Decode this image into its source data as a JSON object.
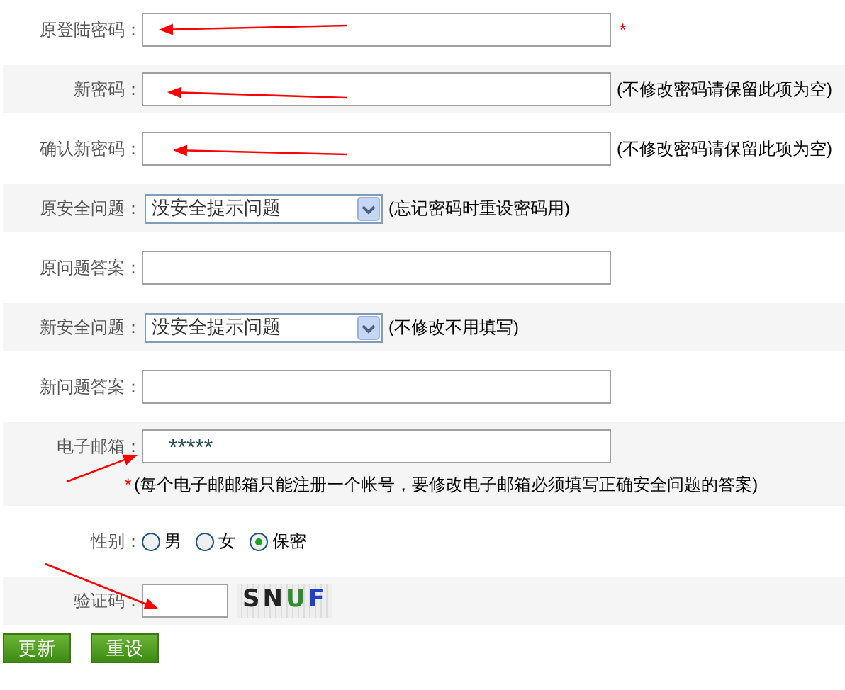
{
  "form": {
    "rows": [
      {
        "kind": "text",
        "label": "原登陆密码：",
        "value": "",
        "mark": "*"
      },
      {
        "kind": "text",
        "label": "新密码：",
        "value": "",
        "note": "(不修改密码请保留此项为空)"
      },
      {
        "kind": "text",
        "label": "确认新密码：",
        "value": "",
        "note": "(不修改密码请保留此项为空)"
      },
      {
        "kind": "select",
        "label": "原安全问题：",
        "value": "没安全提示问题",
        "note": "(忘记密码时重设密码用)"
      },
      {
        "kind": "text",
        "label": "原问题答案：",
        "value": ""
      },
      {
        "kind": "select",
        "label": "新安全问题：",
        "value": "没安全提示问题",
        "note": "(不修改不用填写)"
      },
      {
        "kind": "text",
        "label": "新问题答案：",
        "value": ""
      },
      {
        "kind": "text",
        "label": "电子邮箱：",
        "value": "*****",
        "hint": {
          "mark": "*",
          "text": "(每个电子邮邮箱只能注册一个帐号，要修改电子邮箱必须填写正确安全问题的答案)"
        }
      },
      {
        "kind": "radio",
        "label": "性别：",
        "options": [
          {
            "label": "男",
            "selected": false
          },
          {
            "label": "女",
            "selected": false
          },
          {
            "label": "保密",
            "selected": true
          }
        ]
      },
      {
        "kind": "captcha",
        "label": "验证码：",
        "value": "",
        "captcha": [
          {
            "char": "S",
            "color": "#222222"
          },
          {
            "char": "N",
            "color": "#222222"
          },
          {
            "char": "U",
            "color": "#2e8b2e"
          },
          {
            "char": "F",
            "color": "#2040c0"
          }
        ]
      }
    ]
  },
  "buttons": [
    "更新",
    "重设"
  ]
}
